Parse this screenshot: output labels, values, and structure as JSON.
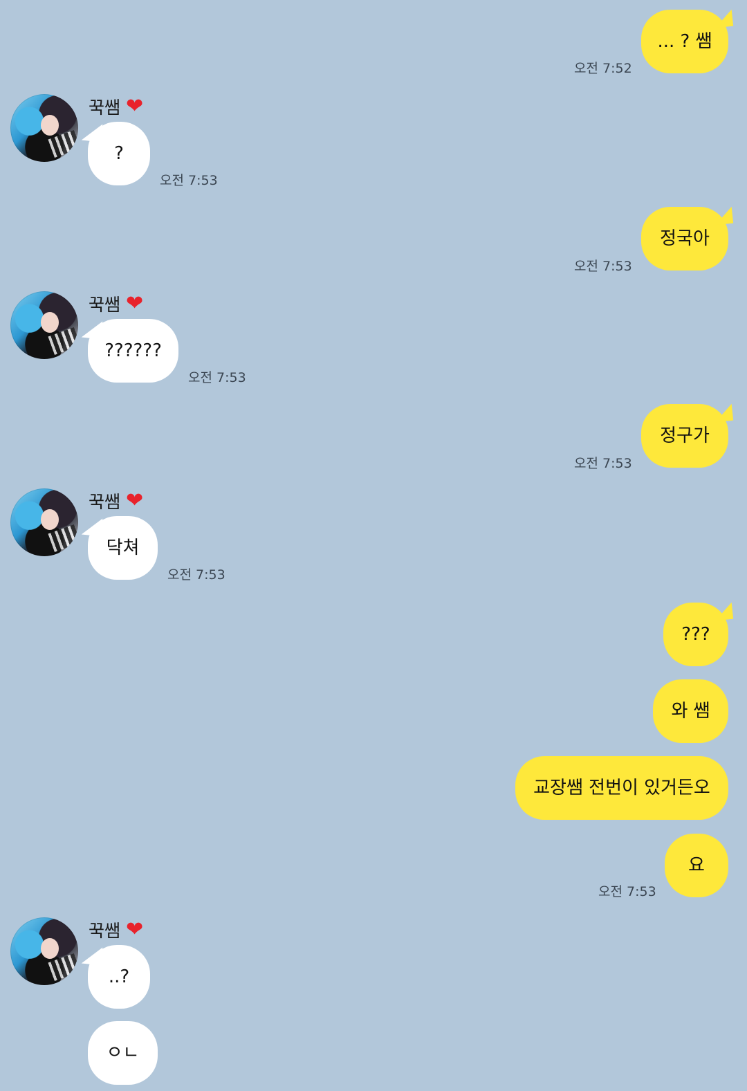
{
  "contact": {
    "name": "꾹쌤",
    "name_emoji": "❤"
  },
  "messages": [
    {
      "from": "me",
      "text": "... ? 쌤",
      "time": "오전 7:52"
    },
    {
      "from": "them",
      "text": "?",
      "time": "오전 7:53"
    },
    {
      "from": "me",
      "text": "정국아",
      "time": "오전 7:53"
    },
    {
      "from": "them",
      "text": "??????",
      "time": "오전 7:53"
    },
    {
      "from": "me",
      "text": "정구가",
      "time": "오전 7:53"
    },
    {
      "from": "them",
      "text": "닥쳐",
      "time": "오전 7:53"
    },
    {
      "from": "me",
      "text": "???",
      "time": ""
    },
    {
      "from": "me",
      "text": "와 쌤",
      "time": ""
    },
    {
      "from": "me",
      "text": "교장쌤 전번이 있거든오",
      "time": ""
    },
    {
      "from": "me",
      "text": "요",
      "time": "오전 7:53"
    },
    {
      "from": "them",
      "text": "..?",
      "time": ""
    },
    {
      "from": "them",
      "text": "ㅇㄴ",
      "time": ""
    }
  ],
  "colors": {
    "background": "#b2c7da",
    "my_bubble": "#fee83b",
    "their_bubble": "#ffffff",
    "heart": "#e8222b"
  },
  "icons": {
    "avatar": "profile-photo",
    "heart": "red-heart-emoji"
  }
}
